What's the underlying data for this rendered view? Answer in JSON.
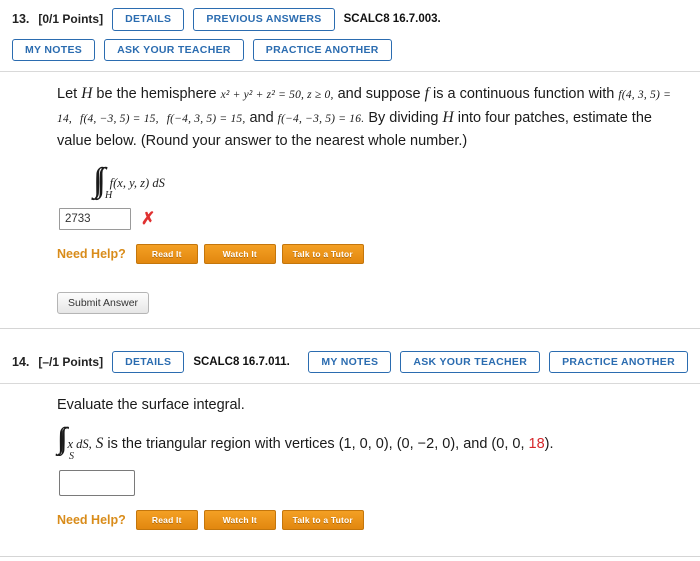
{
  "problem13": {
    "number": "13.",
    "points": "[0/1 Points]",
    "details_label": "DETAILS",
    "previous_answers_label": "PREVIOUS ANSWERS",
    "code": "SCALC8 16.7.003.",
    "my_notes_label": "MY NOTES",
    "ask_teacher_label": "ASK YOUR TEACHER",
    "practice_another_label": "PRACTICE ANOTHER",
    "text_part1": "Let ",
    "var_H": "H",
    "text_part2": " be the hemisphere ",
    "eq_hemisphere": "x² + y² + z² = 50, z ≥ 0,",
    "text_part3": " and suppose ",
    "var_f": "f",
    "text_part4": " is a continuous function with ",
    "val1": "f(4, 3, 5) = 14,",
    "val2": "f(4, −3, 5) = 15,",
    "val3": "f(−4, 3, 5) = 15,",
    "text_and": " and ",
    "val4": "f(−4, −3, 5) = 16.",
    "text_part5": " By dividing ",
    "var_H2": "H",
    "text_part6": " into four patches, estimate the value below. (Round your answer to the nearest whole number.)",
    "integral_sub": "H",
    "integral_arg": "f(x, y, z) dS",
    "answer_value": "2733",
    "answer_mark": "✗",
    "need_help_label": "Need Help?",
    "read_it_label": "Read It",
    "watch_it_label": "Watch It",
    "talk_tutor_label": "Talk to a Tutor",
    "submit_label": "Submit Answer"
  },
  "problem14": {
    "number": "14.",
    "points": "[–/1 Points]",
    "details_label": "DETAILS",
    "code": "SCALC8 16.7.011.",
    "my_notes_label": "MY NOTES",
    "ask_teacher_label": "ASK YOUR TEACHER",
    "practice_another_label": "PRACTICE ANOTHER",
    "prompt": "Evaluate the surface integral.",
    "integral_sub": "S",
    "integral_arg": "x dS,",
    "text_part1": " S",
    "text_part2": " is the triangular region with vertices (1, 0, 0), (0, −2, 0), and (0, 0, ",
    "highlight_value": "18",
    "text_part3": ").",
    "answer_value": "",
    "need_help_label": "Need Help?",
    "read_it_label": "Read It",
    "watch_it_label": "Watch It",
    "talk_tutor_label": "Talk to a Tutor"
  }
}
